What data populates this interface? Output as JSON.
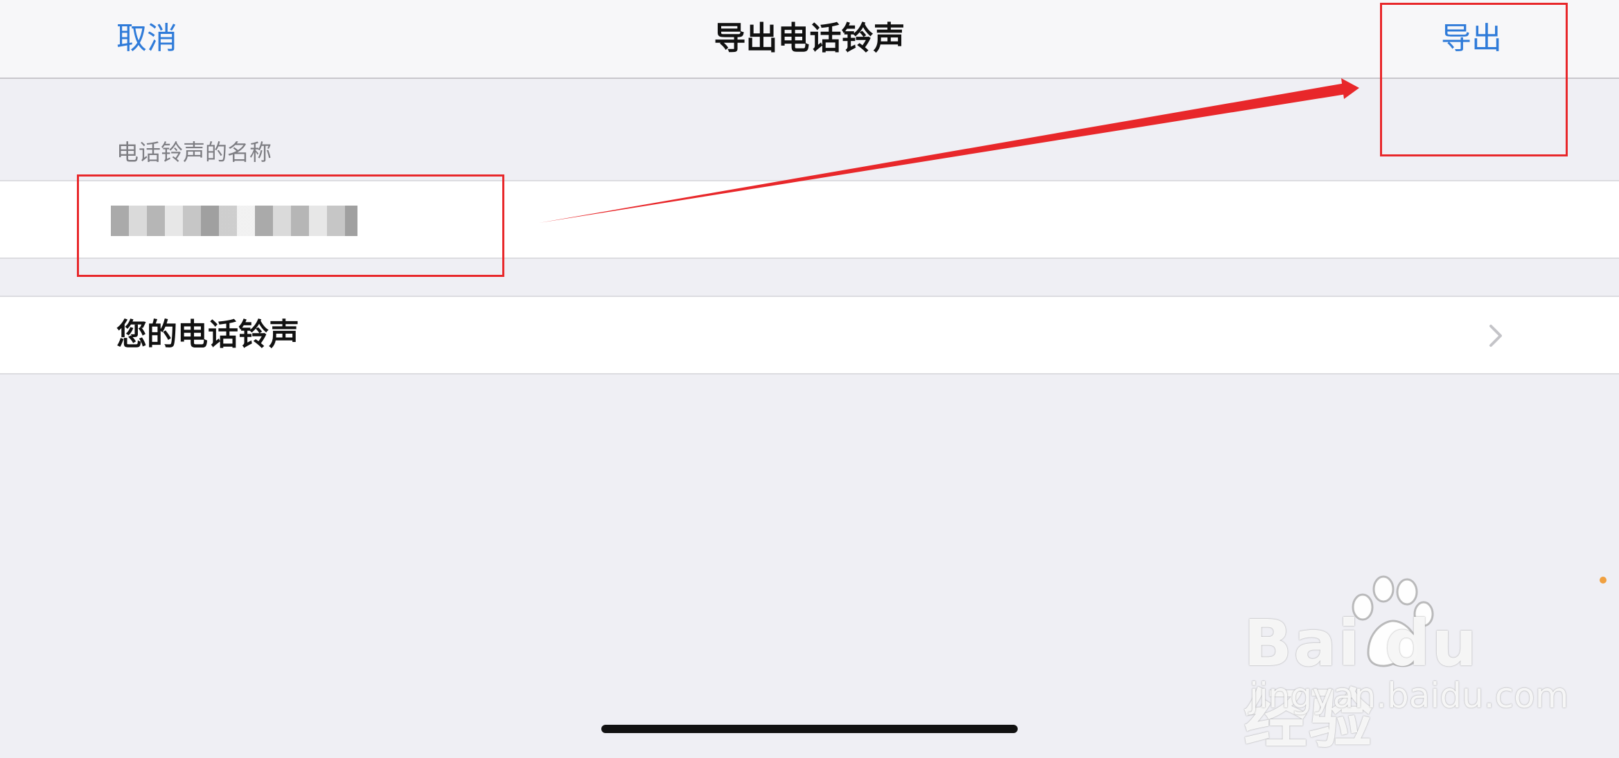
{
  "navbar": {
    "cancel_label": "取消",
    "title": "导出电话铃声",
    "export_label": "导出"
  },
  "form": {
    "section_header": "电话铃声的名称",
    "name_value": ""
  },
  "ringtones_row": {
    "label": "您的电话铃声"
  },
  "watermark": {
    "brand": "Bai du 经验",
    "url": "jingyan.baidu.com"
  },
  "colors": {
    "accent": "#2f7bd9",
    "annotation": "#e8272a",
    "background": "#efeff4"
  }
}
